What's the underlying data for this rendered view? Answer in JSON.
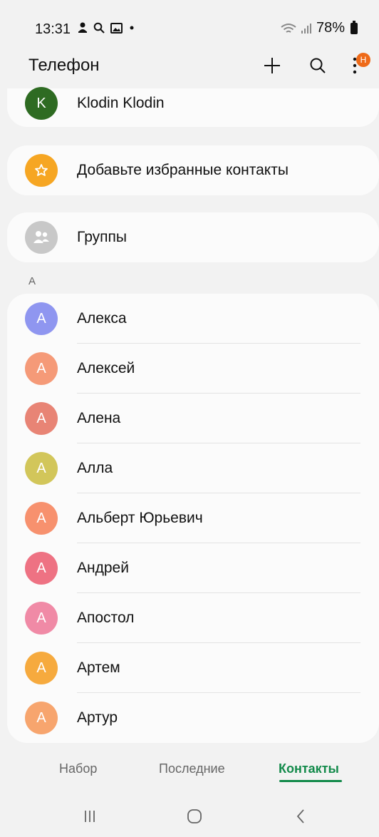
{
  "status_bar": {
    "time": "13:31",
    "battery": "78%",
    "icons": [
      "person-icon",
      "search-icon",
      "image-icon",
      "dot-icon",
      "wifi-icon",
      "signal-icon",
      "battery-icon"
    ]
  },
  "header": {
    "title": "Телефон",
    "badge": "Н"
  },
  "profile": {
    "initial": "K",
    "name": "Klodin Klodin",
    "color": "#2e6b22"
  },
  "favorites": {
    "label": "Добавьте избранные контакты",
    "color": "#f6a623"
  },
  "groups": {
    "label": "Группы",
    "color": "#c8c8c8"
  },
  "section": {
    "letter": "А"
  },
  "contacts": [
    {
      "initial": "А",
      "name": "Алекса",
      "color": "#8f96f0"
    },
    {
      "initial": "А",
      "name": "Алексей",
      "color": "#f59a78"
    },
    {
      "initial": "А",
      "name": "Алена",
      "color": "#e88475"
    },
    {
      "initial": "А",
      "name": "Алла",
      "color": "#d2c65a"
    },
    {
      "initial": "А",
      "name": "Альберт Юрьевич",
      "color": "#f7916e"
    },
    {
      "initial": "А",
      "name": "Андрей",
      "color": "#ee7283"
    },
    {
      "initial": "А",
      "name": "Апостол",
      "color": "#f08aa6"
    },
    {
      "initial": "А",
      "name": "Артем",
      "color": "#f6aa3e"
    },
    {
      "initial": "А",
      "name": "Артур",
      "color": "#f7a56e"
    }
  ],
  "tabs": [
    {
      "label": "Набор"
    },
    {
      "label": "Последние"
    },
    {
      "label": "Контакты"
    }
  ],
  "accent_color": "#128a4a"
}
